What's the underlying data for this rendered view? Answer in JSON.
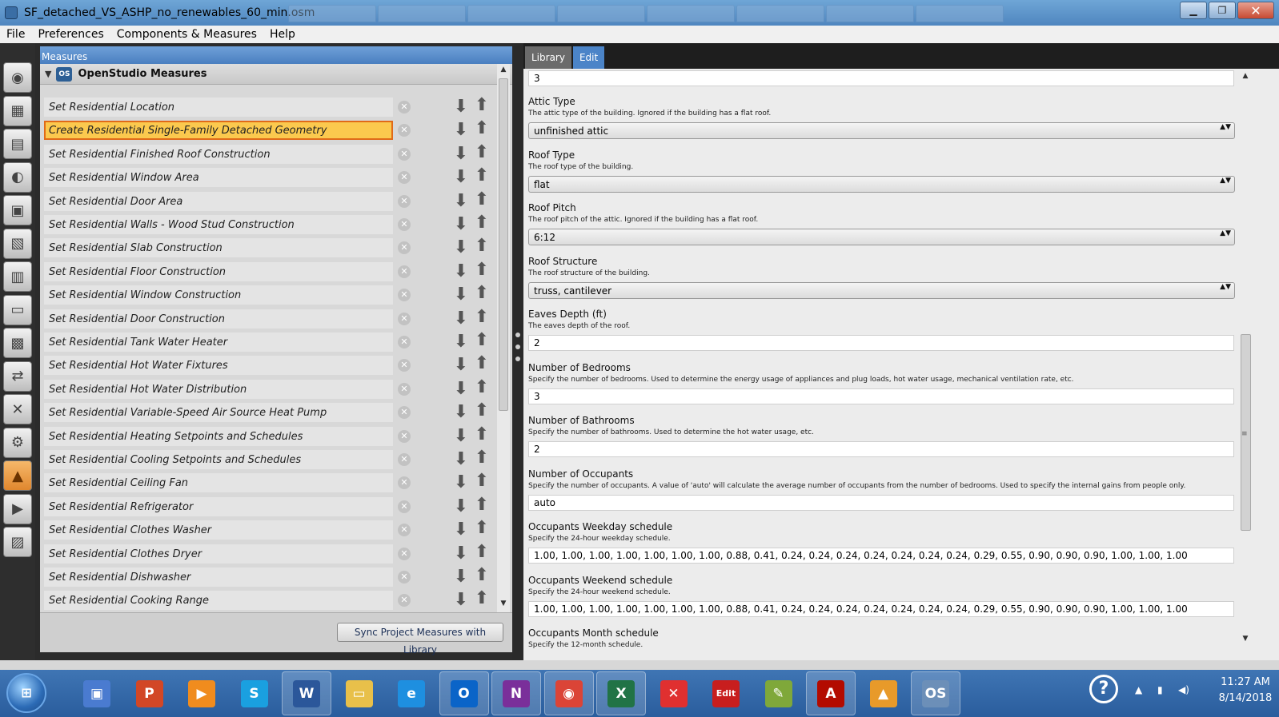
{
  "window": {
    "title": "SF_detached_VS_ASHP_no_renewables_60_min.osm",
    "minimize": "▁",
    "maximize": "❐",
    "close": "✕"
  },
  "menu": [
    "File",
    "Preferences",
    "Components & Measures",
    "Help"
  ],
  "toolstrip": [
    {
      "name": "site-tool",
      "glyph": "◉"
    },
    {
      "name": "schedules-tool",
      "glyph": "▦"
    },
    {
      "name": "constructions-tool",
      "glyph": "▤"
    },
    {
      "name": "loads-tool",
      "glyph": "◐"
    },
    {
      "name": "space-types-tool",
      "glyph": "▣"
    },
    {
      "name": "geometry-tool",
      "glyph": "▧"
    },
    {
      "name": "facility-tool",
      "glyph": "▥"
    },
    {
      "name": "spaces-tool",
      "glyph": "▭"
    },
    {
      "name": "thermal-zones-tool",
      "glyph": "▩"
    },
    {
      "name": "hvac-systems-tool",
      "glyph": "⇄"
    },
    {
      "name": "variables-tool",
      "glyph": "✕"
    },
    {
      "name": "simulation-settings-tool",
      "glyph": "⚙"
    },
    {
      "name": "measures-tool",
      "glyph": "▲"
    },
    {
      "name": "run-simulation-tool",
      "glyph": "▶"
    },
    {
      "name": "results-summary-tool",
      "glyph": "▨"
    }
  ],
  "measures": {
    "header": "Measures",
    "group_title": "OpenStudio Measures",
    "group_logo": "OS",
    "collapse_glyph": "▼",
    "remove_glyph": "✕",
    "down_glyph": "⬇",
    "up_glyph": "⬆",
    "scroll_up": "▲",
    "scroll_down": "▼",
    "items": [
      "Set Residential Location",
      "Create Residential Single-Family Detached Geometry",
      "Set Residential Finished Roof Construction",
      "Set Residential Window Area",
      "Set Residential Door Area",
      "Set Residential Walls - Wood Stud Construction",
      "Set Residential Slab Construction",
      "Set Residential Floor Construction",
      "Set Residential Window Construction",
      "Set Residential Door Construction",
      "Set Residential Tank Water Heater",
      "Set Residential Hot Water Fixtures",
      "Set Residential Hot Water Distribution",
      "Set Residential Variable-Speed Air Source Heat Pump",
      "Set Residential Heating Setpoints and Schedules",
      "Set Residential Cooling Setpoints and Schedules",
      "Set Residential Ceiling Fan",
      "Set Residential Refrigerator",
      "Set Residential Clothes Washer",
      "Set Residential Clothes Dryer",
      "Set Residential Dishwasher",
      "Set Residential Cooking Range"
    ],
    "selected_index": 1,
    "sync_button": "Sync Project Measures with Library"
  },
  "right": {
    "tabs": [
      "Library",
      "Edit"
    ],
    "active_tab": 1,
    "top_value": "3",
    "select_arrow": "▲▼",
    "fields": [
      {
        "label": "Attic Type",
        "desc": "The attic type of the building. Ignored if the building has a flat roof.",
        "kind": "select",
        "value": "unfinished attic"
      },
      {
        "label": "Roof Type",
        "desc": "The roof type of the building.",
        "kind": "select",
        "value": "flat"
      },
      {
        "label": "Roof Pitch",
        "desc": "The roof pitch of the attic. Ignored if the building has a flat roof.",
        "kind": "select",
        "value": "6:12"
      },
      {
        "label": "Roof Structure",
        "desc": "The roof structure of the building.",
        "kind": "select",
        "value": "truss, cantilever"
      },
      {
        "label": "Eaves Depth (ft)",
        "desc": "The eaves depth of the roof.",
        "kind": "input",
        "value": "2"
      },
      {
        "label": "Number of Bedrooms",
        "desc": "Specify the number of bedrooms. Used to determine the energy usage of appliances and plug loads, hot water usage, mechanical ventilation rate, etc.",
        "kind": "input",
        "value": "3"
      },
      {
        "label": "Number of Bathrooms",
        "desc": "Specify the number of bathrooms. Used to determine the hot water usage, etc.",
        "kind": "input",
        "value": "2"
      },
      {
        "label": "Number of Occupants",
        "desc": "Specify the number of occupants. A value of 'auto' will calculate the average number of occupants from the number of bedrooms. Used to specify the internal gains from people only.",
        "kind": "input",
        "value": "auto"
      },
      {
        "label": "Occupants Weekday schedule",
        "desc": "Specify the 24-hour weekday schedule.",
        "kind": "input",
        "value": "1.00, 1.00, 1.00, 1.00, 1.00, 1.00, 1.00, 0.88, 0.41, 0.24, 0.24, 0.24, 0.24, 0.24, 0.24, 0.24, 0.29, 0.55, 0.90, 0.90, 0.90, 1.00, 1.00, 1.00"
      },
      {
        "label": "Occupants Weekend schedule",
        "desc": "Specify the 24-hour weekend schedule.",
        "kind": "input",
        "value": "1.00, 1.00, 1.00, 1.00, 1.00, 1.00, 1.00, 0.88, 0.41, 0.24, 0.24, 0.24, 0.24, 0.24, 0.24, 0.24, 0.29, 0.55, 0.90, 0.90, 0.90, 1.00, 1.00, 1.00"
      },
      {
        "label": "Occupants Month schedule",
        "desc": "Specify the 12-month schedule.",
        "kind": "none",
        "value": ""
      }
    ],
    "scroll_up": "▲",
    "scroll_down": "▼",
    "grip": "≡"
  },
  "taskbar": {
    "start_glyph": "⊞",
    "apps": [
      {
        "name": "remote-desktop-app",
        "glyph": "▣",
        "color": "#4a7bd0",
        "open": false
      },
      {
        "name": "powerpoint-app",
        "glyph": "P",
        "color": "#d24726",
        "open": false
      },
      {
        "name": "media-player-app",
        "glyph": "▶",
        "color": "#f08c1e",
        "open": false
      },
      {
        "name": "skype-app",
        "glyph": "S",
        "color": "#1aa0e0",
        "open": false
      },
      {
        "name": "word-app",
        "glyph": "W",
        "color": "#2b579a",
        "open": true
      },
      {
        "name": "file-explorer-app",
        "glyph": "▭",
        "color": "#e8c04a",
        "open": false
      },
      {
        "name": "internet-explorer-app",
        "glyph": "e",
        "color": "#1e8fe0",
        "open": false
      },
      {
        "name": "outlook-app",
        "glyph": "O",
        "color": "#0a64c8",
        "open": true
      },
      {
        "name": "onenote-app",
        "glyph": "N",
        "color": "#7a2f9a",
        "open": true
      },
      {
        "name": "chrome-app",
        "glyph": "◉",
        "color": "#db4437",
        "open": true
      },
      {
        "name": "excel-app",
        "glyph": "X",
        "color": "#217346",
        "open": true
      },
      {
        "name": "xmind-app",
        "glyph": "✕",
        "color": "#e03030",
        "open": false
      },
      {
        "name": "editplus-app",
        "glyph": "Edit",
        "color": "#c81e1e",
        "open": false
      },
      {
        "name": "notepad-app",
        "glyph": "✎",
        "color": "#7fa83a",
        "open": false
      },
      {
        "name": "acrobat-app",
        "glyph": "A",
        "color": "#b30b00",
        "open": true
      },
      {
        "name": "sketchup-app",
        "glyph": "▲",
        "color": "#e89a2a",
        "open": false
      },
      {
        "name": "openstudio-app",
        "glyph": "OS",
        "color": "#6c8fb8",
        "open": true
      }
    ],
    "help_glyph": "?",
    "tray_up": "▲",
    "tray_battery": "▮",
    "tray_volume": "◀)",
    "time": "11:27 AM",
    "date": "8/14/2018"
  }
}
